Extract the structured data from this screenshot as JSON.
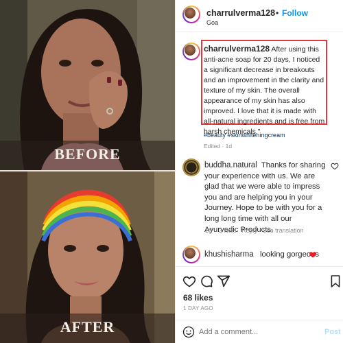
{
  "media": {
    "before_label": "BEFORE",
    "after_label": "AFTER"
  },
  "header": {
    "username": "charrulverma128",
    "dot": "•",
    "follow_label": "Follow",
    "location": "Goa"
  },
  "caption": {
    "username": "charrulverma128",
    "text": "After using this anti-acne soap for 20 days, I noticed a significant decrease in breakouts and an improvement in the clarity and texture of my skin. The overall appearance of my skin has also improved. I love that it is made with all-natural ingredients and is free from harsh chemicals.\"",
    "hashtags": "#beauty #skinwhiteningcream",
    "meta": "Edited · 1d",
    "highlight_color": "#e0393e"
  },
  "comments": [
    {
      "username": "buddha.natural",
      "text": "Thanks for sharing your experience with us. We are glad that we were able to impress you and are helping you in your Journey. Hope to be with you for a long long time with all our Ayurvedic Products.",
      "age": "1d",
      "likes": "2 likes",
      "reply_label": "Reply",
      "translate_label": "See translation"
    },
    {
      "username": "khushisharma",
      "text": "looking gorgeous"
    }
  ],
  "actions": {
    "likes": "68 likes",
    "date": "1 DAY AGO"
  },
  "composer": {
    "placeholder": "Add a comment...",
    "post_label": "Post"
  },
  "colors": {
    "follow": "#0095f6",
    "heart": "#ed4956"
  },
  "icons": [
    "heart-icon",
    "comment-icon",
    "share-icon",
    "bookmark-icon",
    "smiley-icon"
  ]
}
